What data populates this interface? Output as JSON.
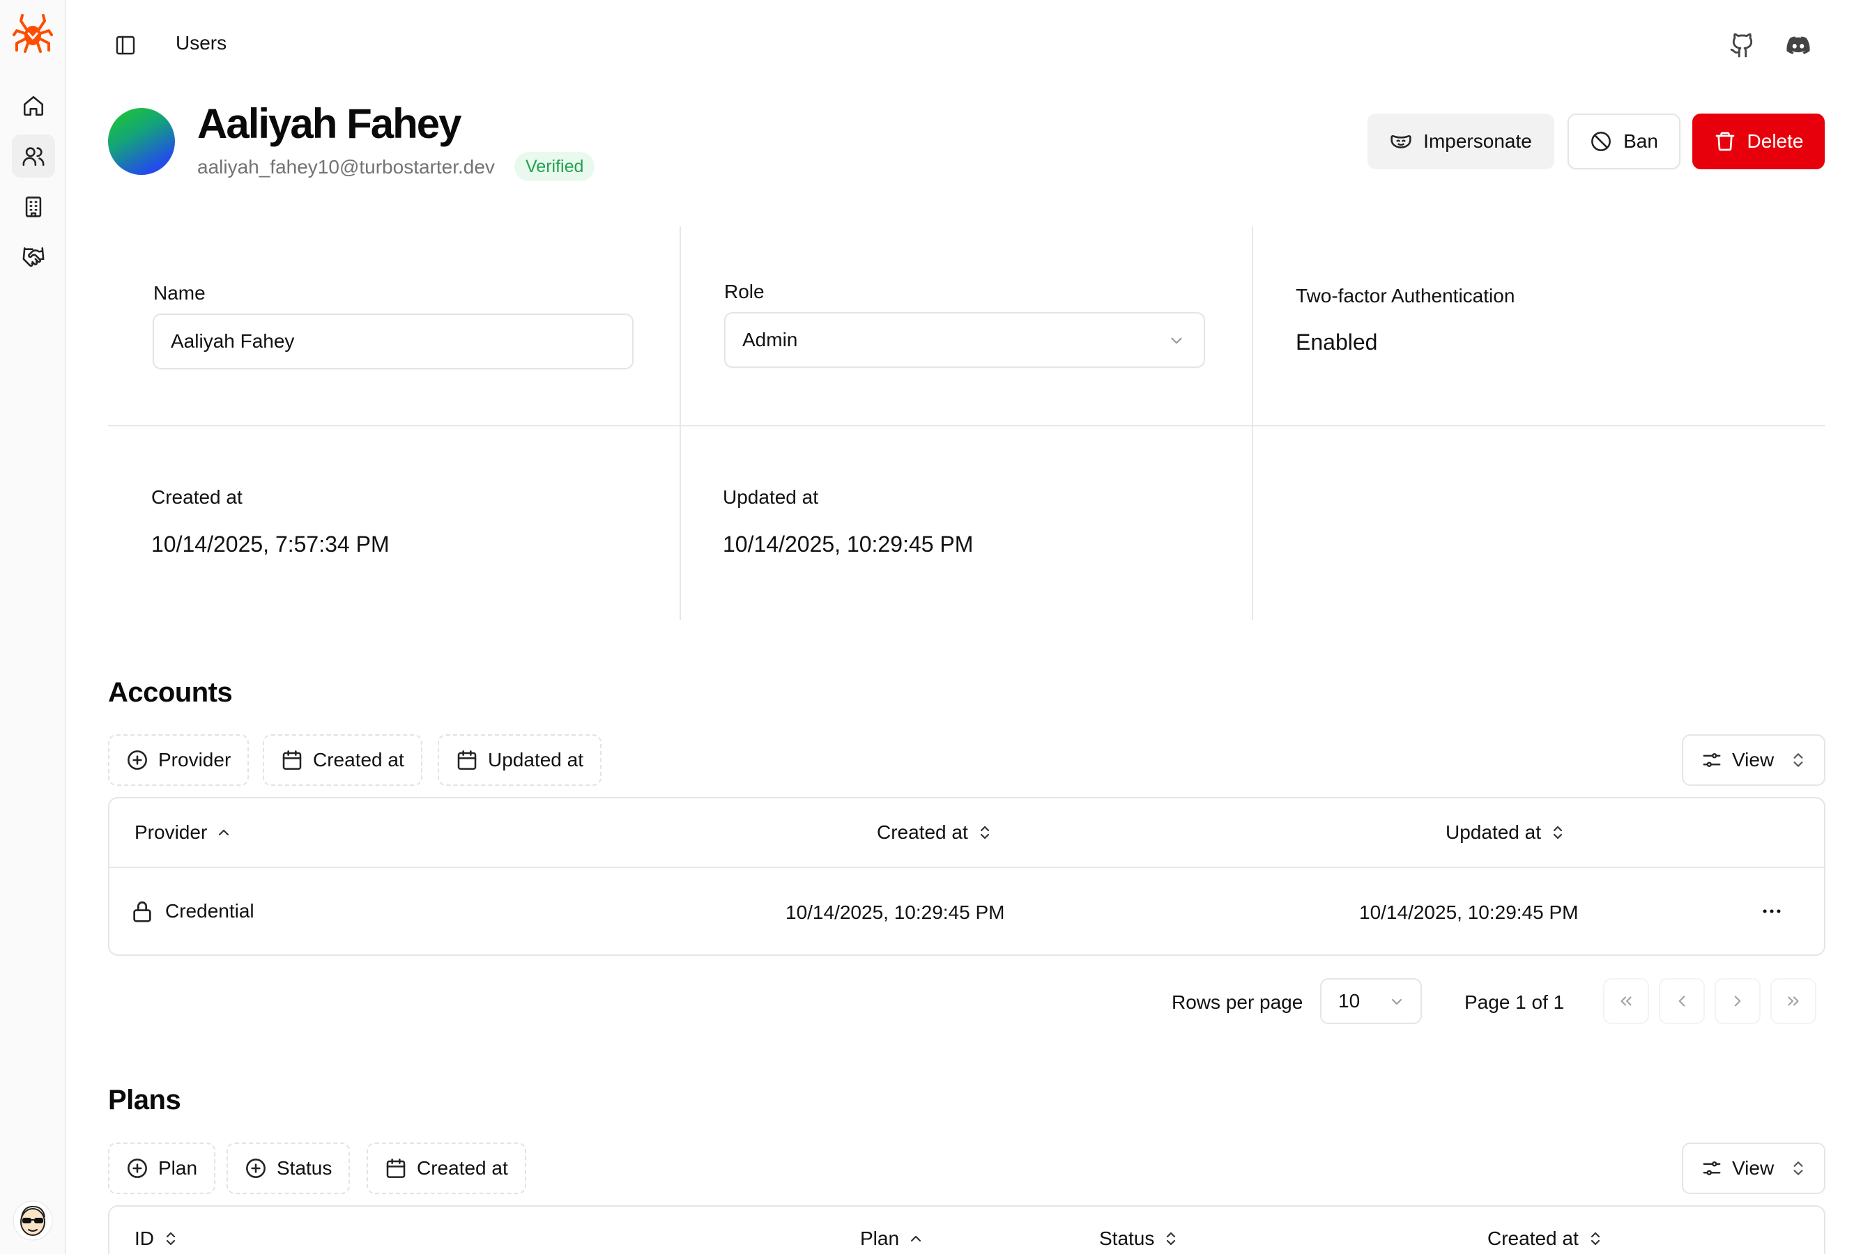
{
  "header": {
    "breadcrumb": "Users"
  },
  "user": {
    "name": "Aaliyah Fahey",
    "email": "aaliyah_fahey10@turbostarter.dev",
    "badge": "Verified"
  },
  "actions": {
    "impersonate": "Impersonate",
    "ban": "Ban",
    "delete": "Delete"
  },
  "details": {
    "name_label": "Name",
    "name_value": "Aaliyah Fahey",
    "role_label": "Role",
    "role_value": "Admin",
    "twofa_label": "Two-factor Authentication",
    "twofa_value": "Enabled",
    "created_label": "Created at",
    "created_value": "10/14/2025, 7:57:34 PM",
    "updated_label": "Updated at",
    "updated_value": "10/14/2025, 10:29:45 PM"
  },
  "accounts": {
    "title": "Accounts",
    "filters": [
      "Provider",
      "Created at",
      "Updated at"
    ],
    "view_label": "View",
    "columns": [
      "Provider",
      "Created at",
      "Updated at"
    ],
    "rows": [
      {
        "provider": "Credential",
        "created_at": "10/14/2025, 10:29:45 PM",
        "updated_at": "10/14/2025, 10:29:45 PM"
      }
    ],
    "rows_per_page_label": "Rows per page",
    "rows_per_page_value": "10",
    "page_label": "Page 1 of 1"
  },
  "plans": {
    "title": "Plans",
    "filters": [
      "Plan",
      "Status",
      "Created at"
    ],
    "view_label": "View",
    "columns": [
      "ID",
      "Plan",
      "Status",
      "Created at"
    ]
  },
  "colors": {
    "danger": "#e7000b",
    "verified_bg": "#e9f9ee",
    "verified_text": "#22a24d",
    "logo": "#ff4d00"
  },
  "icons": {
    "sidebar": [
      "home-icon",
      "users-icon",
      "building-icon",
      "handshake-icon"
    ],
    "top": [
      "github-icon",
      "discord-icon"
    ]
  }
}
